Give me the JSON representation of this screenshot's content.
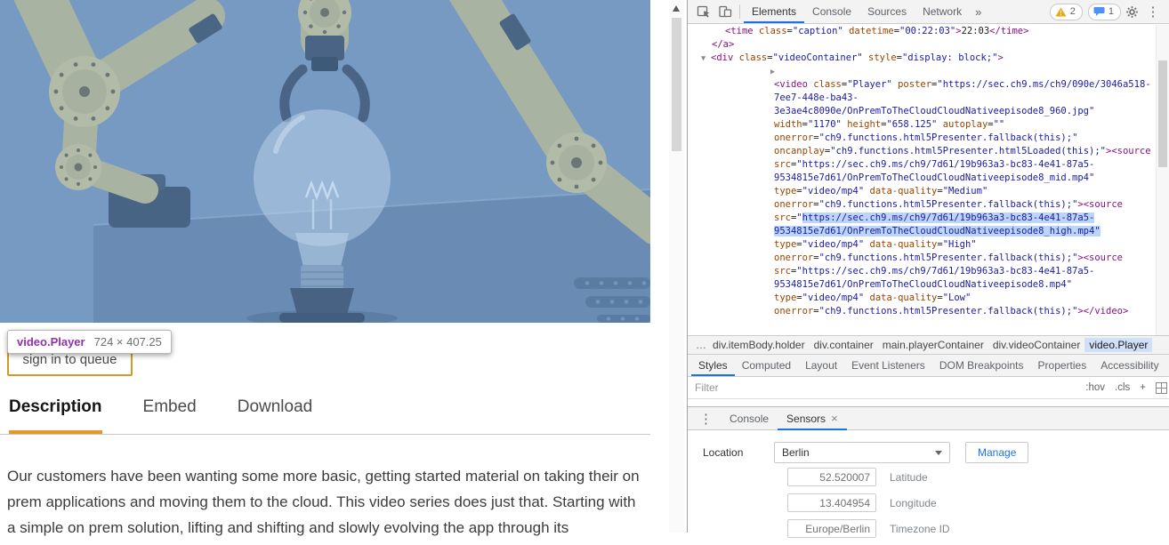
{
  "colors": {
    "accent_orange": "#e09b26",
    "devtools_accent_blue": "#1a73e8",
    "syntax_tag": "#881280",
    "syntax_attr": "#994500",
    "syntax_value": "#1a1aa6",
    "selection_highlight": "#bcd5fa"
  },
  "page": {
    "tooltip": {
      "element": "video.Player",
      "dimensions": "724 × 407.25"
    },
    "queue_button_label": "sign in to queue",
    "tabs": [
      {
        "label": "Description",
        "active": true
      },
      {
        "label": "Embed",
        "active": false
      },
      {
        "label": "Download",
        "active": false
      }
    ],
    "description": "Our customers have been wanting some more basic, getting started material on taking their on prem applications and moving them to the cloud. This video series does just that. Starting with a simple on prem solution, lifting and shifting and slowly evolving the app through its"
  },
  "devtools": {
    "icons": {
      "menu": "⋮"
    },
    "toolbar": {
      "tabs": [
        {
          "label": "Elements",
          "active": true
        },
        {
          "label": "Console",
          "active": false
        },
        {
          "label": "Sources",
          "active": false
        },
        {
          "label": "Network",
          "active": false
        }
      ],
      "more": "»",
      "warning_count": "2",
      "message_count": "1",
      "icon_names": [
        "inspect-icon",
        "device-toolbar-icon",
        "warning-icon",
        "message-bubble-icon",
        "gear-icon",
        "kebab-menu-icon"
      ]
    },
    "elements": {
      "lines": [
        {
          "i": 42,
          "k": [
            [
              "t",
              "<time"
            ],
            [
              "n",
              " class"
            ],
            [
              "p",
              "="
            ],
            [
              "v",
              "\"caption\""
            ],
            [
              "n",
              " datetime"
            ],
            [
              "p",
              "="
            ],
            [
              "v",
              "\"00:22:03\""
            ],
            [
              "t",
              ">"
            ],
            [
              "p",
              "22:03"
            ],
            [
              "t",
              "</time>"
            ]
          ]
        },
        {
          "i": 27,
          "k": [
            [
              "t",
              "</a>"
            ]
          ]
        },
        {
          "i": 15,
          "k": [
            [
              "a",
              "▼"
            ],
            [
              "t",
              "<div"
            ],
            [
              "n",
              " class"
            ],
            [
              "p",
              "="
            ],
            [
              "v",
              "\"videoContainer\""
            ],
            [
              "n",
              " style"
            ],
            [
              "p",
              "="
            ],
            [
              "v",
              "\"display: block;\""
            ],
            [
              "t",
              ">"
            ]
          ]
        },
        {
          "i": 93,
          "k": [
            [
              "a",
              "▶"
            ]
          ]
        },
        {
          "i": 97,
          "k": [
            [
              "t",
              "<video"
            ],
            [
              "n",
              " class"
            ],
            [
              "p",
              "="
            ],
            [
              "v",
              "\"Player\""
            ],
            [
              "n",
              " poster"
            ],
            [
              "p",
              "="
            ],
            [
              "v",
              "\"https://sec.ch9.ms/ch9/090e/3046a518-"
            ]
          ]
        },
        {
          "i": 97,
          "k": [
            [
              "v",
              "7ee7-448e-ba43-"
            ]
          ]
        },
        {
          "i": 97,
          "k": [
            [
              "v",
              "3e3ae4c8090e/OnPremToTheCloudCloudNativeepisode8_960.jpg\""
            ]
          ]
        },
        {
          "i": 97,
          "k": [
            [
              "n",
              "width"
            ],
            [
              "p",
              "="
            ],
            [
              "v",
              "\"1170\""
            ],
            [
              "n",
              " height"
            ],
            [
              "p",
              "="
            ],
            [
              "v",
              "\"658.125\""
            ],
            [
              "n",
              " autoplay"
            ],
            [
              "p",
              "="
            ],
            [
              "v",
              "\"\""
            ]
          ]
        },
        {
          "i": 97,
          "k": [
            [
              "n",
              "onerror"
            ],
            [
              "p",
              "="
            ],
            [
              "v",
              "\"ch9.functions.html5Presenter.fallback(this);\""
            ]
          ]
        },
        {
          "i": 97,
          "k": [
            [
              "n",
              "oncanplay"
            ],
            [
              "p",
              "="
            ],
            [
              "v",
              "\"ch9.functions.html5Presenter.html5Loaded(this);\""
            ],
            [
              "t",
              "><source"
            ]
          ]
        },
        {
          "i": 97,
          "k": [
            [
              "n",
              "src"
            ],
            [
              "p",
              "="
            ],
            [
              "v",
              "\"https://sec.ch9.ms/ch9/7d61/19b963a3-bc83-4e41-87a5-"
            ]
          ]
        },
        {
          "i": 97,
          "k": [
            [
              "v",
              "9534815e7d61/OnPremToTheCloudCloudNativeepisode8_mid.mp4\""
            ]
          ]
        },
        {
          "i": 97,
          "k": [
            [
              "n",
              "type"
            ],
            [
              "p",
              "="
            ],
            [
              "v",
              "\"video/mp4\""
            ],
            [
              "n",
              " data-quality"
            ],
            [
              "p",
              "="
            ],
            [
              "v",
              "\"Medium\""
            ]
          ]
        },
        {
          "i": 97,
          "k": [
            [
              "n",
              "onerror"
            ],
            [
              "p",
              "="
            ],
            [
              "v",
              "\"ch9.functions.html5Presenter.fallback(this);\""
            ],
            [
              "t",
              "><source"
            ]
          ]
        },
        {
          "i": 97,
          "k": [
            [
              "n",
              "src"
            ],
            [
              "p",
              "="
            ],
            [
              "v",
              "\""
            ],
            [
              "h",
              "https://sec.ch9.ms/ch9/7d61/19b963a3-bc83-4e41-87a5-"
            ]
          ]
        },
        {
          "i": 97,
          "k": [
            [
              "h",
              "9534815e7d61/OnPremToTheCloudCloudNativeepisode8_high.mp4\""
            ]
          ]
        },
        {
          "i": 97,
          "k": [
            [
              "n",
              "type"
            ],
            [
              "p",
              "="
            ],
            [
              "v",
              "\"video/mp4\""
            ],
            [
              "n",
              " data-quality"
            ],
            [
              "p",
              "="
            ],
            [
              "v",
              "\"High\""
            ]
          ]
        },
        {
          "i": 97,
          "k": [
            [
              "n",
              "onerror"
            ],
            [
              "p",
              "="
            ],
            [
              "v",
              "\"ch9.functions.html5Presenter.fallback(this);\""
            ],
            [
              "t",
              "><source"
            ]
          ]
        },
        {
          "i": 97,
          "k": [
            [
              "n",
              "src"
            ],
            [
              "p",
              "="
            ],
            [
              "v",
              "\"https://sec.ch9.ms/ch9/7d61/19b963a3-bc83-4e41-87a5-"
            ]
          ]
        },
        {
          "i": 97,
          "k": [
            [
              "v",
              "9534815e7d61/OnPremToTheCloudCloudNativeepisode8.mp4\""
            ]
          ]
        },
        {
          "i": 97,
          "k": [
            [
              "n",
              "type"
            ],
            [
              "p",
              "="
            ],
            [
              "v",
              "\"video/mp4\""
            ],
            [
              "n",
              " data-quality"
            ],
            [
              "p",
              "="
            ],
            [
              "v",
              "\"Low\""
            ]
          ]
        },
        {
          "i": 97,
          "k": [
            [
              "n",
              "onerror"
            ],
            [
              "p",
              "="
            ],
            [
              "v",
              "\"ch9.functions.html5Presenter.fallback(this);\""
            ],
            [
              "t",
              "></video>"
            ]
          ]
        }
      ]
    },
    "breadcrumbs": {
      "overflow": "…",
      "items": [
        {
          "text": "div.itemBody.holder",
          "selected": false
        },
        {
          "text": "div.container",
          "selected": false
        },
        {
          "text": "main.playerContainer",
          "selected": false
        },
        {
          "text": "div.videoContainer",
          "selected": false
        },
        {
          "text": "video.Player",
          "selected": true
        }
      ]
    },
    "sidebar_tabs": [
      {
        "label": "Styles",
        "active": true
      },
      {
        "label": "Computed",
        "active": false
      },
      {
        "label": "Layout",
        "active": false
      },
      {
        "label": "Event Listeners",
        "active": false
      },
      {
        "label": "DOM Breakpoints",
        "active": false
      },
      {
        "label": "Properties",
        "active": false
      },
      {
        "label": "Accessibility",
        "active": false
      }
    ],
    "filter": {
      "placeholder": "Filter",
      "controls": [
        ":hov",
        ".cls",
        "+"
      ]
    },
    "drawer_tabs": [
      {
        "label": "Console",
        "active": false,
        "closable": false
      },
      {
        "label": "Sensors",
        "active": true,
        "closable": true
      }
    ],
    "sensors": {
      "location_label": "Location",
      "location_value": "Berlin",
      "manage_label": "Manage",
      "fields": [
        {
          "value": "52.520007",
          "label": "Latitude"
        },
        {
          "value": "13.404954",
          "label": "Longitude"
        },
        {
          "value": "Europe/Berlin",
          "label": "Timezone ID"
        }
      ]
    }
  }
}
